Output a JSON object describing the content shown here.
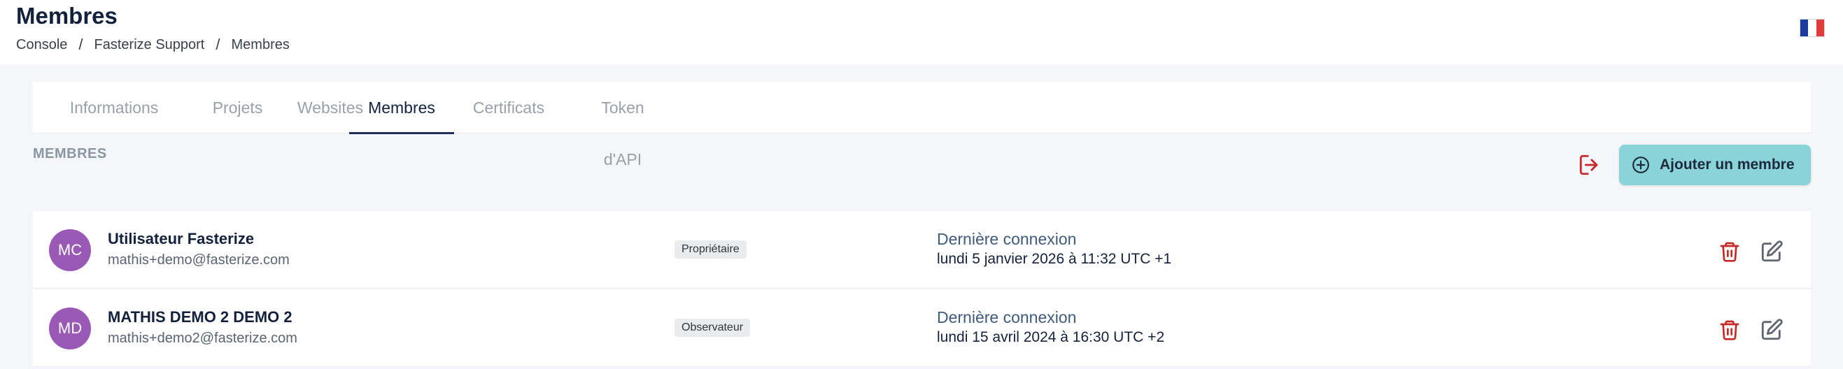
{
  "header": {
    "title": "Membres",
    "breadcrumb": [
      "Console",
      "Fasterize Support",
      "Membres"
    ],
    "language_flag": "fr-flag-icon",
    "flag_colors": [
      "#1a3c9c",
      "#ffffff",
      "#e33a3a"
    ]
  },
  "tabs": [
    {
      "label": "Informations",
      "active": false
    },
    {
      "label": "Projets",
      "active": false
    },
    {
      "label": "Websites",
      "active": false
    },
    {
      "label": "Membres",
      "active": true
    },
    {
      "label": "Certificats",
      "active": false
    },
    {
      "label": "Token d'API",
      "active": false
    }
  ],
  "section": {
    "title": "MEMBRES",
    "leave_icon": "logout-icon",
    "add_button_label": "Ajouter un membre",
    "add_button_icon": "plus-circle-icon",
    "accent_color": "#8ad3d8",
    "danger_color": "#c62828"
  },
  "members": [
    {
      "initials": "MC",
      "name": "Utilisateur Fasterize",
      "email": "mathis+demo@fasterize.com",
      "role": "Propriétaire",
      "last_login_label": "Dernière connexion",
      "last_login": "lundi 5 janvier 2026 à 11:32 UTC +1",
      "avatar_color": "#9b59b6"
    },
    {
      "initials": "MD",
      "name": "MATHIS DEMO 2 DEMO 2",
      "email": "mathis+demo2@fasterize.com",
      "role": "Observateur",
      "last_login_label": "Dernière connexion",
      "last_login": "lundi 15 avril 2024 à 16:30 UTC +2",
      "avatar_color": "#9b59b6"
    }
  ]
}
